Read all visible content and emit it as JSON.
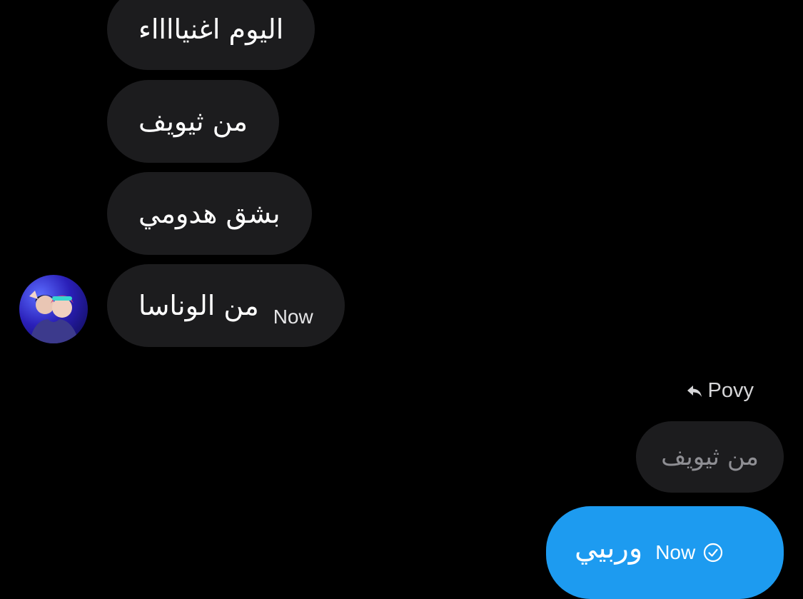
{
  "messages": {
    "received": [
      {
        "text": "اليوم اغنيااااء"
      },
      {
        "text": "من ثيويف"
      },
      {
        "text": "بشق هدومي"
      },
      {
        "text": "من الوناسا",
        "time": "Now"
      }
    ]
  },
  "reply": {
    "label": "Povy",
    "quoted_text": "من ثيويف"
  },
  "sent_message": {
    "text": "وربيي",
    "time": "Now"
  },
  "colors": {
    "background": "#000000",
    "received_bubble": "#1c1c1e",
    "sent_bubble": "#1d9bf0",
    "quoted_text": "#8e8e93"
  },
  "icons": [
    "reply-arrow-icon",
    "sent-status-icon"
  ]
}
